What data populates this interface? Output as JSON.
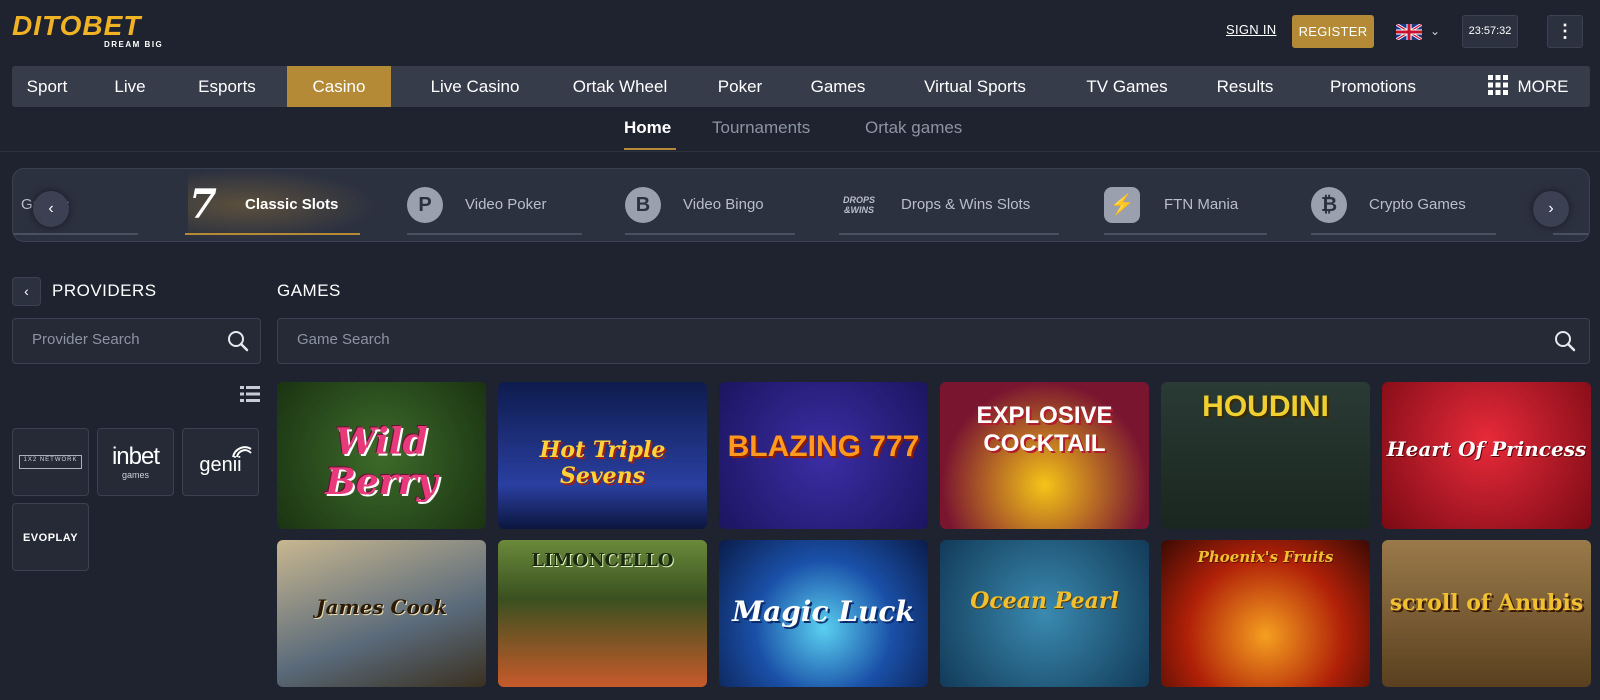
{
  "header": {
    "logo_text": "DITOBET",
    "logo_tagline": "DREAM BIG",
    "sign_in": "SIGN IN",
    "register": "REGISTER",
    "language_icon": "uk-flag-icon",
    "clock": "23:57:32"
  },
  "main_nav": {
    "items": [
      "Sport",
      "Live",
      "Esports",
      "Casino",
      "Live Casino",
      "Ortak Wheel",
      "Poker",
      "Games",
      "Virtual Sports",
      "TV Games",
      "Results",
      "Promotions"
    ],
    "active": "Casino",
    "more_label": "MORE",
    "accent_color": "#b48a36"
  },
  "sub_nav": {
    "items": [
      "Home",
      "Tournaments",
      "Ortak games"
    ],
    "active": "Home"
  },
  "categories": {
    "items": [
      {
        "label": "Games",
        "icon": "games-icon"
      },
      {
        "label": "Classic Slots",
        "icon": "seven-icon"
      },
      {
        "label": "Video Poker",
        "icon": "poker-chip-icon"
      },
      {
        "label": "Video Bingo",
        "icon": "bingo-ball-icon"
      },
      {
        "label": "Drops & Wins Slots",
        "icon": "drops-wins-icon"
      },
      {
        "label": "FTN Mania",
        "icon": "lightning-icon"
      },
      {
        "label": "Crypto Games",
        "icon": "bitcoin-icon"
      }
    ],
    "active": "Classic Slots"
  },
  "providers": {
    "title": "PROVIDERS",
    "search_placeholder": "Provider Search",
    "items": [
      "1X2 NETWORK",
      "inbet",
      "genii",
      "EVOPLAY"
    ],
    "inbet_sub": "games"
  },
  "games": {
    "title": "GAMES",
    "search_placeholder": "Game Search",
    "tiles": [
      {
        "title": "Wild Berry"
      },
      {
        "title": "Hot Triple Sevens"
      },
      {
        "title": "BLAZING 777"
      },
      {
        "title": "EXPLOSIVE COCKTAIL"
      },
      {
        "title": "HOUDINI"
      },
      {
        "title": "Heart Of Princess"
      },
      {
        "title": "James Cook"
      },
      {
        "title": "LIMONCELLO"
      },
      {
        "title": "Magic Luck"
      },
      {
        "title": "Ocean Pearl"
      },
      {
        "title": "Phoenix's Fruits"
      },
      {
        "title": "scroll of Anubis"
      }
    ]
  }
}
